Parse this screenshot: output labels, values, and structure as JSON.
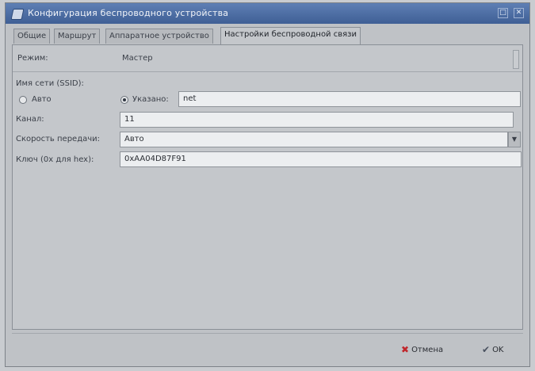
{
  "window": {
    "title": "Конфигурация беспроводного устройства",
    "minimize_glyph": "□",
    "close_glyph": "✕"
  },
  "tabs": [
    {
      "label": "Общие",
      "active": false
    },
    {
      "label": "Маршрут",
      "active": false
    },
    {
      "label": "Аппаратное устройство",
      "active": false
    },
    {
      "label": "Настройки беспроводной связи",
      "active": true
    }
  ],
  "form": {
    "mode_label": "Режим:",
    "mode_value": "Мастер",
    "ssid_label": "Имя сети (SSID):",
    "auto_label": "Авто",
    "specified_label": "Указано:",
    "ssid_value": "net",
    "channel_label": "Канал:",
    "channel_value": "11",
    "rate_label": "Скорость передачи:",
    "rate_value": "Авто",
    "key_label": "Ключ (0x для hex):",
    "key_value": "0xAA04D87F91"
  },
  "buttons": {
    "cancel": "Отмена",
    "ok": "OK"
  }
}
